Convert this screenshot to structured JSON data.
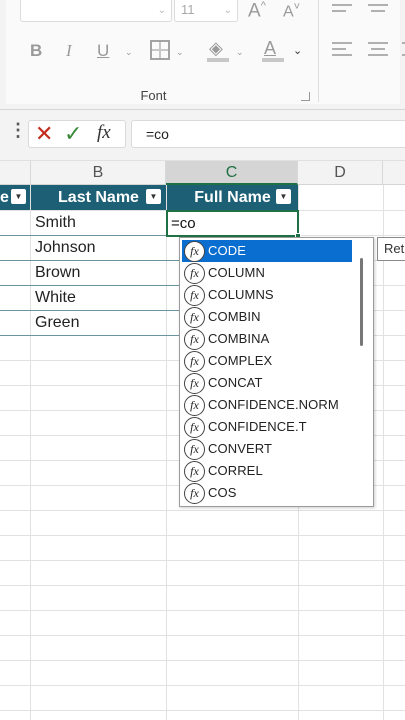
{
  "ribbon": {
    "font_name_value": "",
    "font_size_value": "11",
    "grow_font_icon": "A^",
    "shrink_font_icon": "A˅",
    "bold_label": "B",
    "italic_label": "I",
    "underline_label": "U",
    "font_color_label": "A",
    "group_label": "Font"
  },
  "formula_bar": {
    "more_icon": "⋮",
    "cancel_icon": "✕",
    "enter_icon": "✓",
    "fx_label": "fx",
    "value": "=co"
  },
  "columns": {
    "b": "B",
    "c": "C",
    "d": "D"
  },
  "table": {
    "headers": {
      "first_name_partial": "e",
      "last_name": "Last Name",
      "full_name": "Full Name"
    },
    "rows": [
      {
        "last_name": "Smith"
      },
      {
        "last_name": "Johnson"
      },
      {
        "last_name": "Brown"
      },
      {
        "last_name": "White"
      },
      {
        "last_name": "Green"
      }
    ],
    "active_cell_value": "=co"
  },
  "autocomplete": {
    "icon_text": "fx",
    "items": [
      "CODE",
      "COLUMN",
      "COLUMNS",
      "COMBIN",
      "COMBINA",
      "COMPLEX",
      "CONCAT",
      "CONFIDENCE.NORM",
      "CONFIDENCE.T",
      "CONVERT",
      "CORREL",
      "COS"
    ],
    "selected_index": 0
  },
  "tooltip": {
    "text": "Ret"
  },
  "colors": {
    "header_fill": "#1d5f74",
    "selection_green": "#1e7145",
    "selection_blue": "#0a6ed1"
  }
}
